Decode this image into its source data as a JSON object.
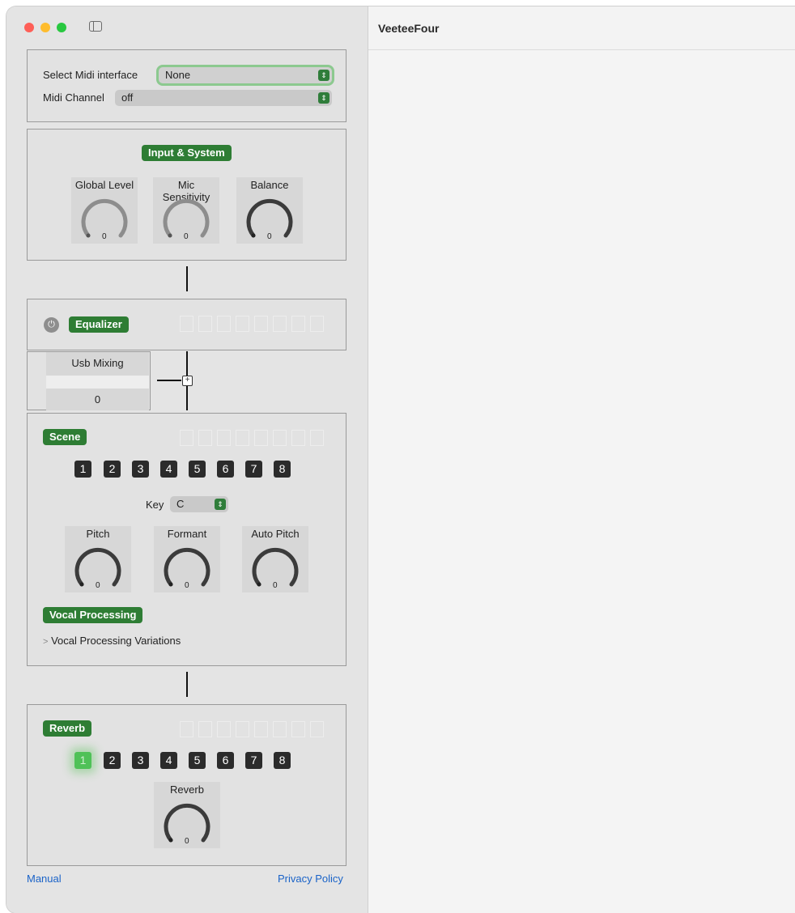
{
  "window": {
    "title": "VeeteeFour"
  },
  "midi": {
    "interface_label": "Select Midi interface",
    "interface_value": "None",
    "channel_label": "Midi Channel",
    "channel_value": "off"
  },
  "input_system": {
    "title": "Input & System",
    "knobs": [
      {
        "label": "Global Level",
        "value": "0"
      },
      {
        "label": "Mic Sensitivity",
        "value": "0"
      },
      {
        "label": "Balance",
        "value": "0"
      }
    ]
  },
  "equalizer": {
    "title": "Equalizer"
  },
  "usb_mixing": {
    "label": "Usb Mixing",
    "value": "0"
  },
  "scene": {
    "title": "Scene",
    "buttons": [
      "1",
      "2",
      "3",
      "4",
      "5",
      "6",
      "7",
      "8"
    ],
    "key_label": "Key",
    "key_value": "C",
    "knobs": [
      {
        "label": "Pitch",
        "value": "0"
      },
      {
        "label": "Formant",
        "value": "0"
      },
      {
        "label": "Auto Pitch",
        "value": "0"
      }
    ],
    "vocal_processing": "Vocal Processing",
    "variations": "Vocal Processing Variations"
  },
  "reverb": {
    "title": "Reverb",
    "buttons": [
      "1",
      "2",
      "3",
      "4",
      "5",
      "6",
      "7",
      "8"
    ],
    "knob": {
      "label": "Reverb",
      "value": "0"
    }
  },
  "footer": {
    "manual": "Manual",
    "privacy": "Privacy Policy"
  },
  "colors": {
    "accent_green": "#2e7d34",
    "active_green": "#4fc157",
    "link_blue": "#1a63c8"
  },
  "icons": {
    "power": "power-icon",
    "plus": "plus-icon",
    "disclosure": "chevron-right-icon",
    "sidebar": "sidebar-toggle-icon"
  }
}
